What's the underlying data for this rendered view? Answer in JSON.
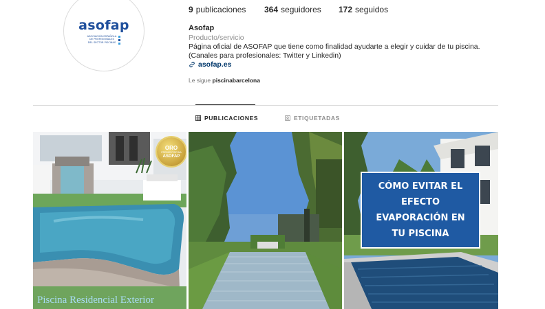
{
  "profile": {
    "logo": {
      "word": "asofap",
      "sub_lines": [
        "ASOCIACIÓN ESPAÑOLA",
        "DE PROFESIONALES",
        "DEL SECTOR PISCINAS"
      ]
    },
    "stats": {
      "posts_count": "9",
      "posts_label": "publicaciones",
      "followers_count": "364",
      "followers_label": "seguidores",
      "following_count": "172",
      "following_label": "seguidos"
    },
    "name": "Asofap",
    "category": "Producto/servicio",
    "bio_line1": "Página oficial de ASOFAP que tiene como finalidad ayudarte a elegir y cuidar de tu piscina.",
    "bio_line2": "(Canales para profesionales: Twitter y Linkedin)",
    "link": "asofap.es",
    "followed_by_prefix": "Le sigue",
    "followed_by_user": "piscinabarcelona"
  },
  "tabs": [
    {
      "label": "PUBLICACIONES",
      "icon": "grid-icon",
      "active": true
    },
    {
      "label": "ETIQUETADAS",
      "icon": "tagged-icon",
      "active": false
    }
  ],
  "posts": [
    {
      "caption": "Piscina Residencial Exterior",
      "badge": {
        "line1": "ORO",
        "line2": "PREMIO PISCINA",
        "line3": "ASOFAP"
      }
    },
    {},
    {
      "overlay_lines": [
        "CÓMO EVITAR EL",
        "EFECTO",
        "EVAPORACIÓN EN",
        "TU PISCINA"
      ]
    }
  ],
  "colors": {
    "link": "#00376b",
    "brand": "#1f4f9c",
    "promo_box": "#1f5aa3",
    "caption_text": "#a9dcf5"
  }
}
